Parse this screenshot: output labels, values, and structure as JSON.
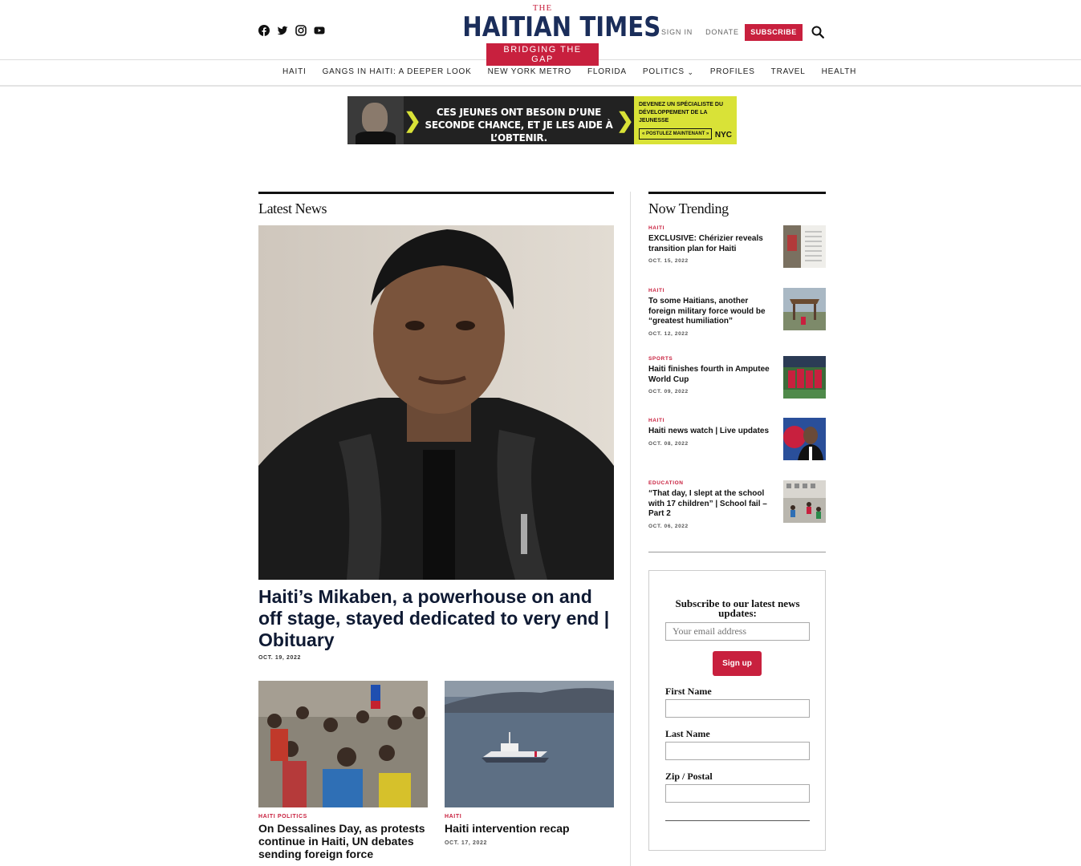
{
  "header": {
    "logo_the": "THE",
    "logo_name": "HAITIAN TIMES",
    "logo_tagline": "BRIDGING THE GAP",
    "sign_in": "SIGN IN",
    "donate": "DONATE",
    "subscribe": "SUBSCRIBE",
    "social_icons": [
      "facebook-icon",
      "twitter-icon",
      "instagram-icon",
      "youtube-icon"
    ]
  },
  "nav": {
    "items": [
      "HAITI",
      "GANGS IN HAITI: A DEEPER LOOK",
      "NEW YORK METRO",
      "FLORIDA",
      "POLITICS",
      "PROFILES",
      "TRAVEL",
      "HEALTH"
    ]
  },
  "ad": {
    "headline": "CES JEUNES ONT BESOIN D’UNE SECONDE CHANCE, ET JE LES AIDE À L’OBTENIR.",
    "side_text": "DEVENEZ UN SPÉCIALISTE DU DÉVELOPPEMENT DE LA JEUNESSE",
    "cta": "« POSTULEZ MAINTENANT »",
    "brand": "NYC"
  },
  "latest": {
    "heading": "Latest News",
    "hero": {
      "title": "Haiti’s Mikaben, a powerhouse on and off stage, stayed dedicated to very end | Obituary",
      "date": "OCT. 19, 2022"
    },
    "cards": [
      {
        "category": "HAITI POLITICS",
        "title": "On Dessalines Day, as protests continue in Haiti, UN debates sending foreign force",
        "date": ""
      },
      {
        "category": "HAITI",
        "title": "Haiti intervention recap",
        "date": "OCT. 17, 2022"
      }
    ]
  },
  "trending": {
    "heading": "Now Trending",
    "items": [
      {
        "category": "HAITI",
        "title": "EXCLUSIVE: Chérizier reveals transition plan for Haiti",
        "date": "OCT. 15, 2022"
      },
      {
        "category": "HAITI",
        "title": "To some Haitians, another foreign military force would be “greatest humiliation”",
        "date": "OCT. 12, 2022"
      },
      {
        "category": "SPORTS",
        "title": "Haiti finishes fourth in Amputee World Cup",
        "date": "OCT. 09, 2022"
      },
      {
        "category": "HAITI",
        "title": "Haiti news watch | Live updates",
        "date": "OCT. 08, 2022"
      },
      {
        "category": "EDUCATION",
        "title": "“That day, I slept at the school with 17 children” |  School fail – Part 2",
        "date": "OCT. 06, 2022"
      }
    ]
  },
  "subscribe_box": {
    "heading": "Subscribe to our latest news updates:",
    "email_placeholder": "Your email address",
    "button": "Sign up",
    "first_name": "First Name",
    "last_name": "Last Name",
    "zip": "Zip / Postal"
  },
  "colors": {
    "brand_red": "#c8203e",
    "brand_navy": "#1a2d5a"
  }
}
